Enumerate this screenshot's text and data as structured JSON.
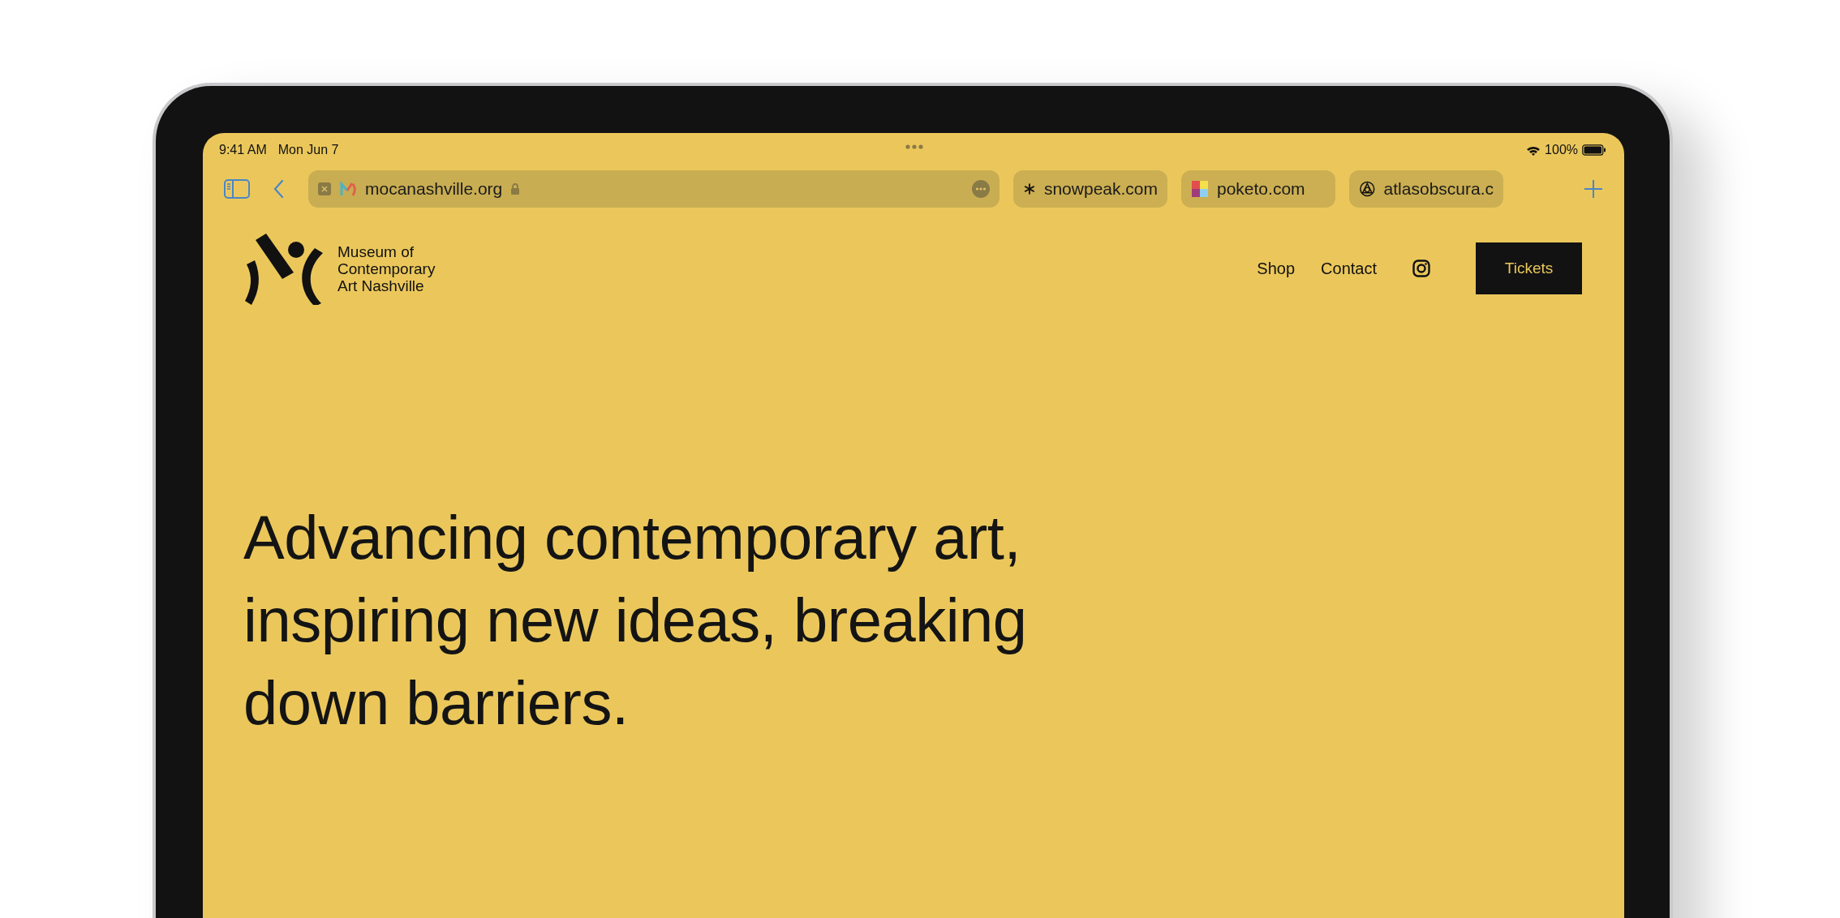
{
  "status_bar": {
    "time": "9:41 AM",
    "date": "Mon Jun 7",
    "battery": "100%"
  },
  "tabs": [
    {
      "label": "mocanashville.org",
      "selected": true
    },
    {
      "label": "snowpeak.com",
      "selected": false
    },
    {
      "label": "poketo.com",
      "selected": false
    },
    {
      "label": "atlasobscura.c",
      "selected": false
    }
  ],
  "site": {
    "logo_text": [
      "Museum of",
      "Contemporary",
      "Art Nashville"
    ],
    "nav": [
      "Shop",
      "Contact"
    ],
    "cta": "Tickets",
    "headline": "Advancing contemporary art, inspiring new ideas, breaking down barriers."
  }
}
